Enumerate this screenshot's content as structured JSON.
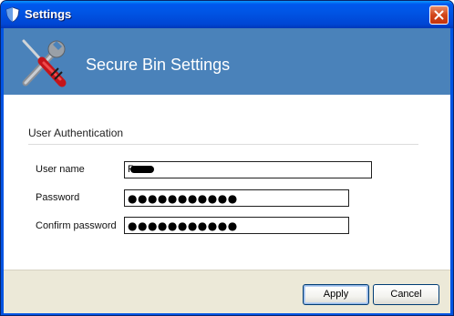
{
  "window": {
    "title": "Settings"
  },
  "banner": {
    "title": "Secure Bin Settings"
  },
  "section": {
    "title": "User Authentication"
  },
  "fields": {
    "username_label": "User name",
    "username_value": "R",
    "password_label": "Password",
    "password_value": "●●●●●●●●●●●",
    "confirm_label": "Confirm password",
    "confirm_value": "●●●●●●●●●●●"
  },
  "footer": {
    "apply_label": "Apply",
    "cancel_label": "Cancel"
  },
  "icons": {
    "title_icon": "shield-icon",
    "banner_icon": "tools-icon",
    "close_icon": "close-icon"
  },
  "colors": {
    "banner": "#4a82ba",
    "titlebar": "#0054e3",
    "footer": "#ece9d8",
    "close": "#d2461a"
  }
}
